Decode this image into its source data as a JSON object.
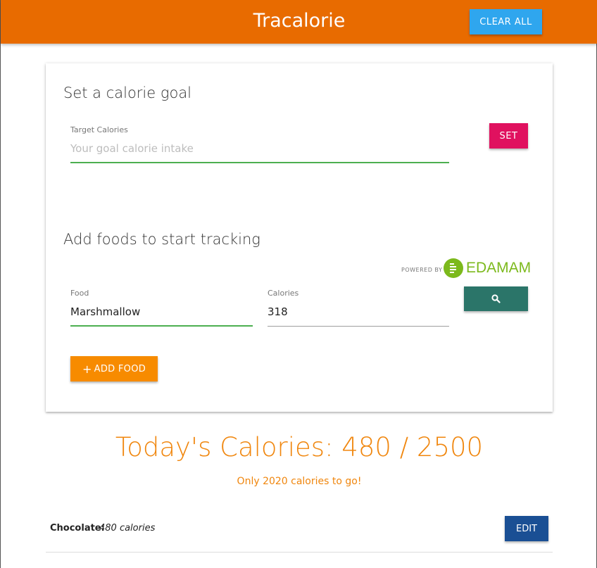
{
  "navbar": {
    "brand": "Tracalorie",
    "clear_all_label": "CLEAR ALL",
    "color": "#e86b00"
  },
  "goal_section": {
    "title": "Set a calorie goal",
    "target_label": "Target Calories",
    "target_placeholder": "Your goal calorie intake",
    "target_value": "",
    "set_label": "SET"
  },
  "food_section": {
    "title": "Add foods to start tracking",
    "powered_by": "POWERED BY",
    "powered_brand": "EDAMAM",
    "food_label": "Food",
    "food_value": "Marshmallow",
    "calories_label": "Calories",
    "calories_value": "318",
    "search_icon": "search-icon",
    "add_label": "ADD FOOD",
    "add_icon": "plus-icon"
  },
  "summary": {
    "total_text": "Today's Calories: 480 / 2500",
    "consumed": 480,
    "goal": 2500,
    "remaining_text": "Only 2020 calories to go!"
  },
  "items": [
    {
      "name": "Chocolate:",
      "calories": "480 calories",
      "edit_label": "EDIT"
    }
  ],
  "colors": {
    "accent": "#f0860d",
    "set_button": "#e0115f",
    "search_button": "#2b7569",
    "clear_button": "#2fa6ee",
    "edit_button": "#1a4f94",
    "edamam_green": "#7cb91c"
  }
}
